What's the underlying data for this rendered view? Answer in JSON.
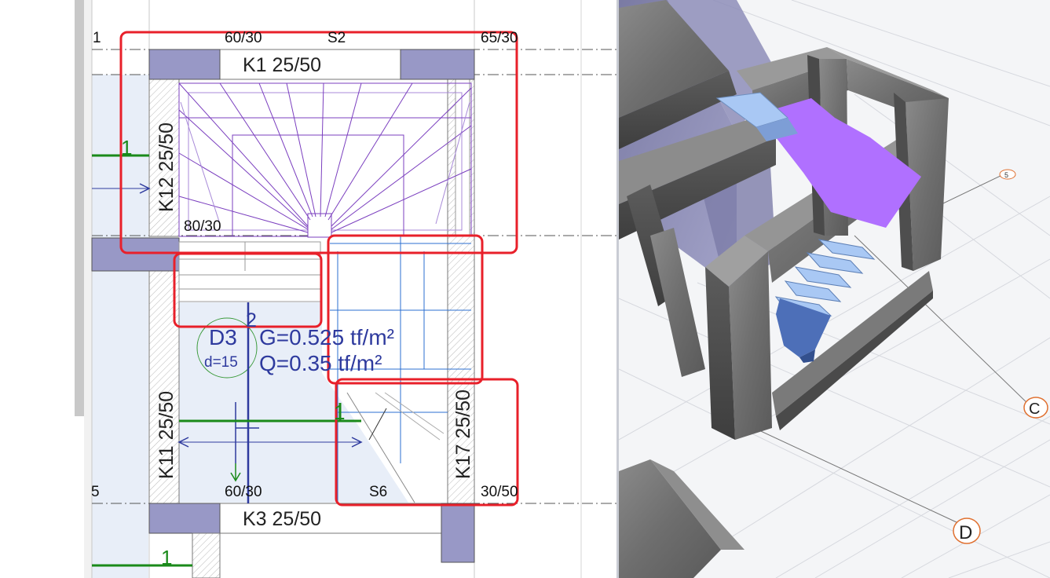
{
  "plan": {
    "grid_labels": {
      "left_top": "1",
      "left_bottom": "5"
    },
    "columns": {
      "top_left": "60/30",
      "top_mid": "S2",
      "top_right": "65/30",
      "mid_left": "80/30",
      "bottom_left": "60/30",
      "bottom_mid": "S6",
      "bottom_right": "30/50"
    },
    "beams": {
      "k1": "K1 25/50",
      "k12": "K12 25/50",
      "k11": "K11 25/50",
      "k17": "K17 25/50",
      "k3": "K3 25/50"
    },
    "section_marks": {
      "top": "1",
      "bottom": "1",
      "mid": "1",
      "stair_no": "2"
    },
    "slab": {
      "id": "D3",
      "thickness": "d=15",
      "dead_load": "G=0.525 tf/m²",
      "live_load": "Q=0.35 tf/m²"
    }
  },
  "model": {
    "axis_labels": {
      "c": "C",
      "d": "D",
      "five": "5"
    }
  },
  "colors": {
    "highlight": "#e8202a",
    "stair_lines": "#7b3fbf",
    "dimension": "#2e3a9e",
    "section": "#1a8a1a",
    "column_fill": "#9898c6",
    "slab_fill": "#e8eef8",
    "landing": "#b070ff",
    "steps": "#a9c8f4"
  },
  "icons": [
    "concrete-frame-icon"
  ]
}
